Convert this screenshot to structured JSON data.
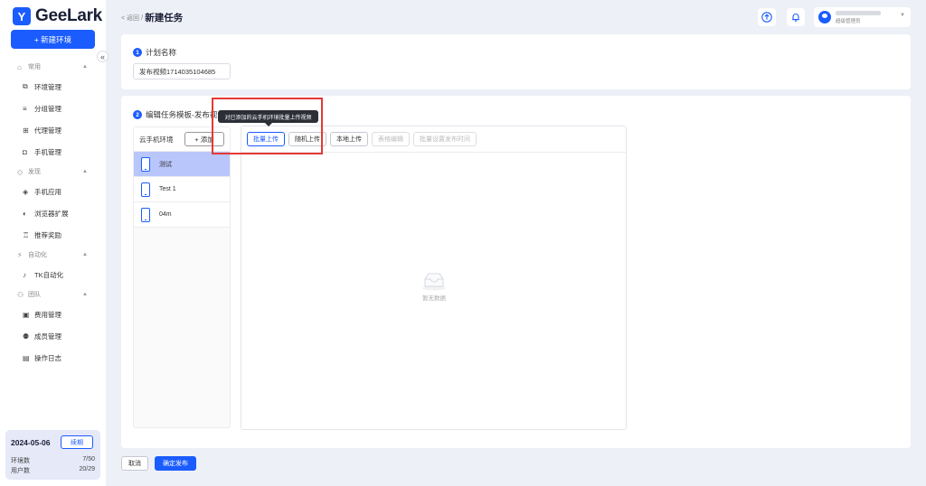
{
  "app": {
    "name": "GeeLark",
    "logo_letter": "Y"
  },
  "sidebar": {
    "new_env_label": "+ 新建环境",
    "collapse_glyph": "«",
    "groups": [
      {
        "label": "常用",
        "items": [
          "环境管理",
          "分组管理",
          "代理管理",
          "手机管理"
        ]
      },
      {
        "label": "发现",
        "items": [
          "手机应用",
          "浏览器扩展",
          "推荐奖励"
        ]
      },
      {
        "label": "自动化",
        "items": [
          "TK自动化"
        ]
      },
      {
        "label": "团队",
        "items": [
          "费用管理",
          "成员管理",
          "操作日志"
        ]
      }
    ],
    "date": "2024-05-06",
    "renew_label": "续期",
    "stats": [
      {
        "label": "环境数",
        "value": "7/50"
      },
      {
        "label": "用户数",
        "value": "20/29"
      }
    ]
  },
  "header": {
    "back_label": "< 返回",
    "separator": "/",
    "title": "新建任务",
    "user_role": "超级管理员"
  },
  "step1": {
    "num": "1",
    "title": "计划名称",
    "input_value": "发布视频1714035104685"
  },
  "step2": {
    "num": "2",
    "title": "编辑任务模板-发布视",
    "env_header": "云手机环境",
    "add_label": "+ 添加",
    "envs": [
      "测试",
      "Test 1",
      "04m"
    ],
    "toolbar": [
      "批量上传",
      "随机上传",
      "本地上传",
      "表格编辑",
      "批量设置发布时间"
    ],
    "empty_text": "暂无数据",
    "tooltip": "对已添加的云手机环境批量上传视频"
  },
  "footer": {
    "cancel_label": "取消",
    "confirm_label": "确定发布"
  },
  "colors": {
    "accent": "#1b5cff",
    "highlight": "#e53935",
    "active_row": "#b8c6fb"
  }
}
